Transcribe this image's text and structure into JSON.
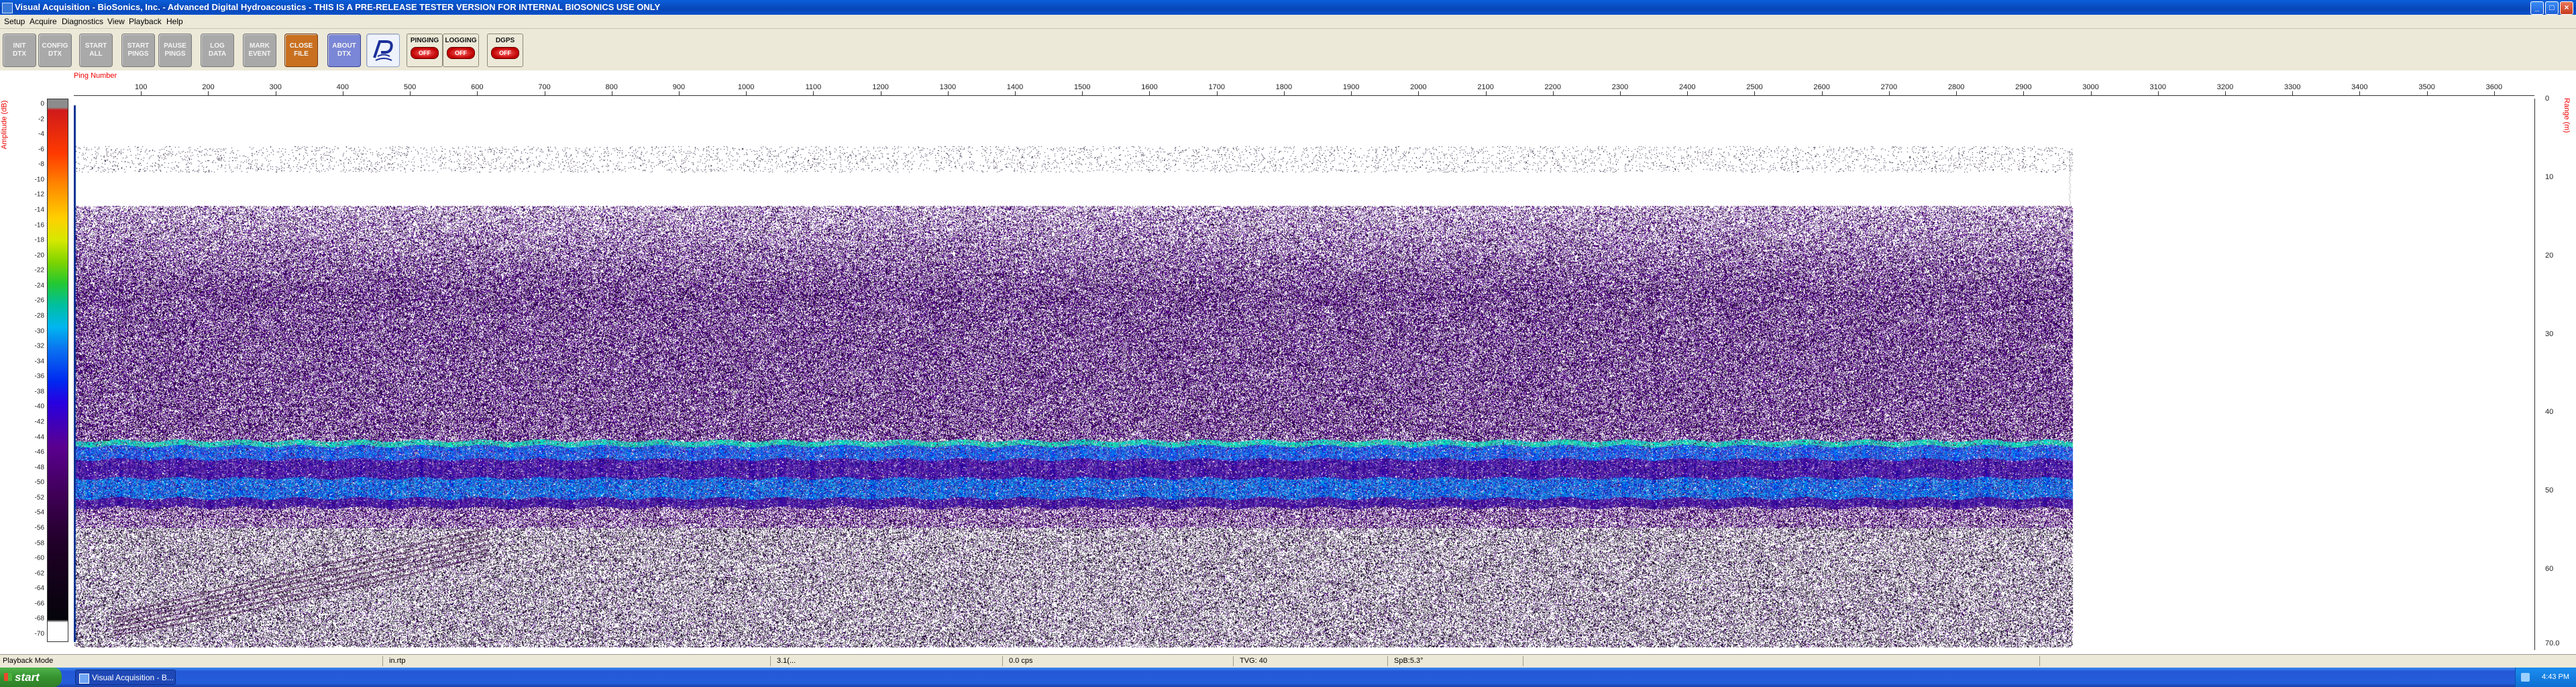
{
  "window": {
    "title": "Visual Acquisition  -  BioSonics, Inc.  -  Advanced Digital Hydroacoustics  -  THIS IS A PRE-RELEASE TESTER VERSION FOR INTERNAL BIOSONICS USE ONLY",
    "minimize": "_",
    "maximize": "□",
    "close": "×"
  },
  "menu": [
    "Setup",
    "Acquire",
    "Diagnostics",
    "View",
    "Playback",
    "Help"
  ],
  "toolbar": {
    "buttons": [
      {
        "line1": "INIT",
        "line2": "DTX"
      },
      {
        "line1": "CONFIG",
        "line2": "DTX"
      },
      {
        "line1": "START",
        "line2": "ALL"
      },
      {
        "line1": "START",
        "line2": "PINGS"
      },
      {
        "line1": "PAUSE",
        "line2": "PINGS"
      },
      {
        "line1": "LOG",
        "line2": "DATA"
      },
      {
        "line1": "MARK",
        "line2": "EVENT"
      },
      {
        "line1": "CLOSE",
        "line2": "FILE"
      },
      {
        "line1": "ABOUT",
        "line2": "DTX"
      }
    ],
    "indicators": [
      {
        "label": "PINGING",
        "state": "OFF"
      },
      {
        "label": "LOGGING",
        "state": "OFF"
      },
      {
        "label": "DGPS",
        "state": "OFF"
      }
    ]
  },
  "plot": {
    "ping_label": "Ping Number",
    "left_axis_label": "Amplitude (dB)",
    "right_axis_label": "Range (m)",
    "x_ticks": [
      "100",
      "200",
      "300",
      "400",
      "500",
      "600",
      "700",
      "800",
      "900",
      "1000",
      "1100",
      "1200",
      "1300",
      "1400",
      "1500",
      "1600",
      "1700",
      "1800",
      "1900",
      "2000",
      "2100",
      "2200",
      "2300",
      "2400",
      "2500",
      "2600",
      "2700",
      "2800",
      "2900",
      "3000",
      "3100",
      "3200",
      "3300",
      "3400",
      "3500",
      "3600"
    ],
    "x_max": 3660,
    "colorbar_ticks": [
      "0",
      "-2",
      "-4",
      "-6",
      "-8",
      "-10",
      "-12",
      "-14",
      "-16",
      "-18",
      "-20",
      "-22",
      "-24",
      "-26",
      "-28",
      "-30",
      "-32",
      "-34",
      "-36",
      "-38",
      "-40",
      "-42",
      "-44",
      "-46",
      "-48",
      "-50",
      "-52",
      "-54",
      "-56",
      "-58",
      "-60",
      "-62",
      "-64",
      "-66",
      "-68",
      "-70"
    ],
    "range_ticks": [
      "0",
      "10",
      "20",
      "30",
      "40",
      "50",
      "60",
      "70.0"
    ],
    "range_max": 70
  },
  "status": [
    "Playback Mode",
    "in.rtp",
    "3.1(...",
    "0.0 cps",
    "TVG: 40",
    "SpB:5.3°"
  ],
  "taskbar": {
    "start": "start",
    "task": "Visual Acquisition - B...",
    "clock": "4:43 PM"
  }
}
